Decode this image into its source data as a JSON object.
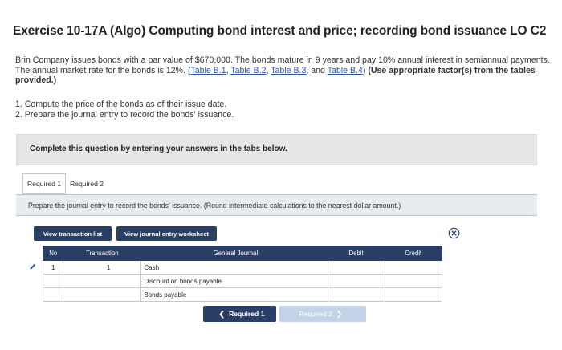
{
  "exercise": {
    "title": "Exercise 10-17A (Algo) Computing bond interest and price; recording bond issuance LO C2"
  },
  "problem": {
    "text_1": "Brin Company issues bonds with a par value of $670,000. The bonds mature in 9 years and pay 10% annual interest in semiannual payments. The annual market rate for the bonds is 12%. ",
    "link_b1": "(Table B.1",
    "sep_1": ", ",
    "link_b2": "Table B.2",
    "sep_2": ", ",
    "link_b3": "Table B.3",
    "sep_3": ", and ",
    "link_b4": "Table B.4",
    "close_paren": ")",
    "bold_text": " (Use appropriate factor(s) from the tables provided.)"
  },
  "steps": [
    "1. Compute the price of the bonds as of their issue date.",
    "2. Prepare the journal entry to record the bonds' issuance."
  ],
  "instruction": "Complete this question by entering your answers in the tabs below.",
  "tabs": [
    {
      "label": "Required 1",
      "active": true
    },
    {
      "label": "Required 2",
      "active": false
    }
  ],
  "prompt": "Prepare the journal entry to record the bonds' issuance. (Round intermediate calculations to the nearest dollar amount.)",
  "buttons": {
    "view_transaction_list": "View transaction list",
    "view_journal_worksheet": "View journal entry worksheet",
    "required_1": "Required 1",
    "required_2": "Required 2"
  },
  "journal": {
    "headers": [
      "No",
      "Transaction",
      "General Journal",
      "Debit",
      "Credit"
    ],
    "rows": [
      {
        "no": "1",
        "transaction": "1",
        "account": "Cash",
        "debit": "",
        "credit": ""
      },
      {
        "no": "",
        "transaction": "",
        "account": "Discount on bonds payable",
        "debit": "",
        "credit": ""
      },
      {
        "no": "",
        "transaction": "",
        "account": "Bonds payable",
        "debit": "",
        "credit": ""
      }
    ]
  },
  "colors": {
    "nav_dark": "#2a3f66",
    "link_blue": "#2a57a8",
    "prompt_bg": "#e8ecf1",
    "disabled_btn": "#c3d2e6"
  },
  "icons": {
    "close": "close-circle-icon",
    "edit": "pencil-icon",
    "prev": "chevron-left-icon",
    "next": "chevron-right-icon"
  }
}
